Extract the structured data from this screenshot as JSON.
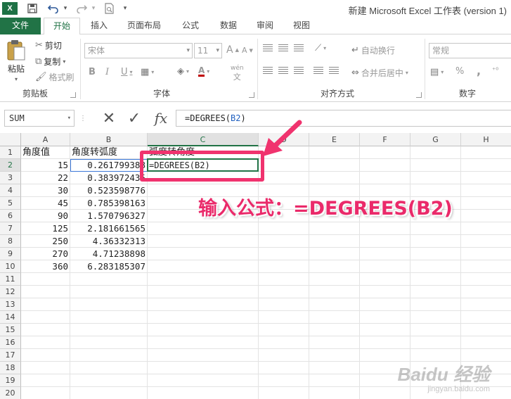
{
  "titlebar": {
    "app_logo": "X",
    "save_icon": "save-icon",
    "undo_icon": "undo-icon",
    "redo_icon": "redo-icon",
    "print_preview_icon": "print-preview-icon",
    "customize_icon": "customize-qat-icon",
    "document_title": "新建 Microsoft Excel 工作表 (version 1)"
  },
  "tabs": [
    "文件",
    "开始",
    "插入",
    "页面布局",
    "公式",
    "数据",
    "审阅",
    "视图"
  ],
  "ribbon": {
    "clipboard": {
      "paste": "粘贴",
      "cut": "剪切",
      "copy": "复制",
      "format_painter": "格式刷",
      "label": "剪贴板"
    },
    "font": {
      "font_name": "宋体",
      "font_size": "11",
      "bold": "B",
      "italic": "I",
      "underline": "U",
      "grow": "A",
      "shrink": "A",
      "phonetic": "wén",
      "label": "字体"
    },
    "alignment": {
      "wrap_text": "自动换行",
      "merge_center": "合并后居中",
      "label": "对齐方式"
    },
    "number": {
      "format": "常规",
      "percent": "%",
      "comma": ",",
      "label": "数字"
    }
  },
  "formula_bar": {
    "name_box": "SUM",
    "cancel": "✕",
    "enter": "✓",
    "fx": "fx",
    "formula_prefix": "=DEGREES(",
    "formula_ref": "B2",
    "formula_suffix": ")"
  },
  "columns": [
    "A",
    "B",
    "C",
    "D",
    "E",
    "F",
    "G",
    "H"
  ],
  "rows": [
    "1",
    "2",
    "3",
    "4",
    "5",
    "6",
    "7",
    "8",
    "9",
    "10",
    "11",
    "12",
    "13",
    "14",
    "15",
    "16",
    "17",
    "18",
    "19",
    "20"
  ],
  "cells": {
    "A1": "角度值",
    "B1": "角度转弧度",
    "C1": "弧度转角度",
    "A": [
      "15",
      "22",
      "30",
      "45",
      "90",
      "125",
      "250",
      "270",
      "360"
    ],
    "B": [
      "0.261799388",
      "0.383972435",
      "0.523598776",
      "0.785398163",
      "1.570796327",
      "2.181661565",
      "4.36332313",
      "4.71238898",
      "6.283185307"
    ],
    "C2": "=DEGREES(B2)"
  },
  "annotation": {
    "text": "输入公式：=DEGREES(B2)",
    "color": "#ea2a6a"
  },
  "watermark": {
    "main": "Baidu 经验",
    "sub": "jingyan.baidu.com"
  },
  "colors": {
    "excel_green": "#217346",
    "reference_blue": "#3c78d8"
  }
}
